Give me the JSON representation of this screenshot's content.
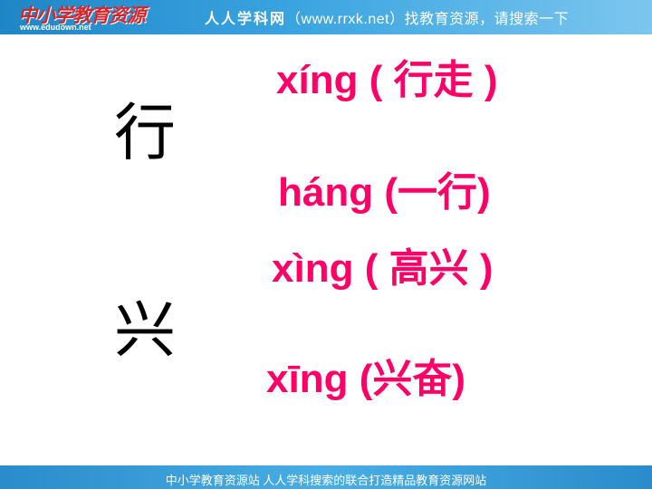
{
  "header": {
    "logo_text": "中小学教育资源",
    "logo_url": "www.edudown.net",
    "site_name": "人人学科网",
    "slogan": "（www.rrxk.net）找教育资源，请搜索一下"
  },
  "characters": [
    {
      "char": "行",
      "readings": [
        {
          "pinyin": "xíng",
          "open": "(",
          "word": "行走",
          "close": ")"
        },
        {
          "pinyin": "háng",
          "open": "(",
          "word": "一行",
          "close": ")"
        }
      ]
    },
    {
      "char": "兴",
      "readings": [
        {
          "pinyin": "xìng",
          "open": "(",
          "word": "高兴",
          "close": ")"
        },
        {
          "pinyin": "xīng",
          "open": "(",
          "word": "兴奋",
          "close": ")"
        }
      ]
    }
  ],
  "footer": {
    "text": "中小学教育资源站  人人学科搜索的联合打造精品教育资源网站"
  },
  "colors": {
    "pinyin": "#ff0066",
    "character": "#000000",
    "banner": "#3aa4e0"
  }
}
